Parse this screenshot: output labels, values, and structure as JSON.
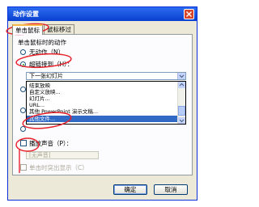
{
  "window": {
    "title": "动作设置"
  },
  "tabs": [
    {
      "label": "单击鼠标"
    },
    {
      "label": "鼠标移过"
    }
  ],
  "group": {
    "title": "单击鼠标时的动作"
  },
  "options": {
    "none": "无动作（N）",
    "hyperlink": "超链接到（H）：",
    "run_program": "",
    "run_macro": "",
    "object_action": ""
  },
  "hyperlink_combo": {
    "value": "下一张幻灯片"
  },
  "dropdown_items": [
    "结束放映",
    "自定义放映...",
    "幻灯片...",
    "URL...",
    "其他 PowerPoint 演示文稿...",
    "其他文件..."
  ],
  "play_sound": {
    "label": "播放声音（P）：",
    "value": "[无声音]"
  },
  "highlight": {
    "label": "单击时突出显示（C）"
  },
  "buttons": {
    "ok": "确定",
    "cancel": "取消"
  },
  "colors": {
    "annotation": "#e8202a",
    "selection": "#316ac5",
    "title_bar": "#0a3fcf"
  }
}
